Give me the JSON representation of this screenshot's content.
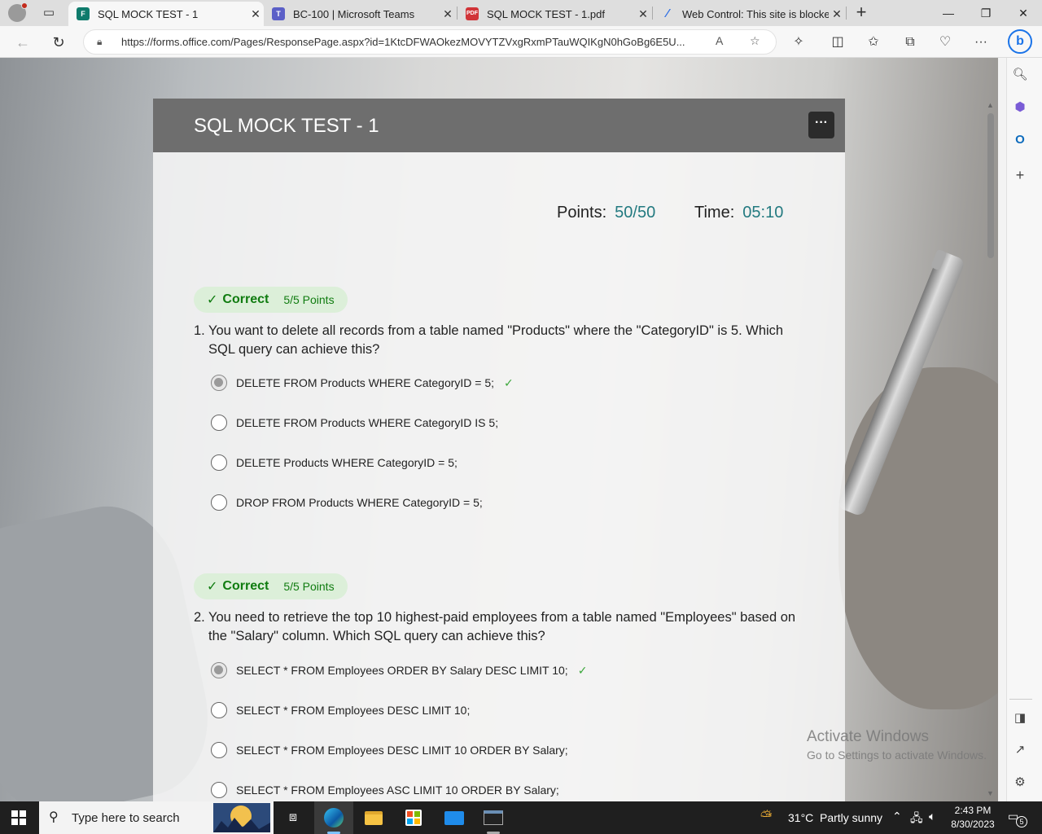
{
  "browser": {
    "tabs": [
      {
        "label": "SQL MOCK TEST - 1",
        "icon": "forms-icon",
        "active": true
      },
      {
        "label": "BC-100 | Microsoft Teams",
        "icon": "teams-icon",
        "active": false
      },
      {
        "label": "SQL MOCK TEST - 1.pdf",
        "icon": "pdf-icon",
        "active": false
      },
      {
        "label": "Web Control: This site is blocked.",
        "icon": "webcontrol-icon",
        "active": false
      }
    ],
    "url": "https://forms.office.com/Pages/ResponsePage.aspx?id=1KtcDFWAOkezMOVYTZVxgRxmPTauWQIKgN0hGoBg6E5U..."
  },
  "form": {
    "title": "SQL MOCK TEST - 1",
    "points_label": "Points:",
    "points_value": "50/50",
    "time_label": "Time:",
    "time_value": "05:10",
    "questions": [
      {
        "number": "1.",
        "badge": "Correct",
        "points": "5/5 Points",
        "text": "You want to delete all records from a table named \"Products\" where the \"CategoryID\" is 5. Which SQL query can achieve this?",
        "options": [
          "DELETE FROM Products WHERE CategoryID = 5;",
          "DELETE FROM Products WHERE CategoryID IS 5;",
          "DELETE Products WHERE CategoryID = 5;",
          "DROP FROM Products WHERE CategoryID = 5;"
        ],
        "selected": 0
      },
      {
        "number": "2.",
        "badge": "Correct",
        "points": "5/5 Points",
        "text": "You need to retrieve the top 10 highest-paid employees from a table named \"Employees\" based on the \"Salary\" column. Which SQL query can achieve this?",
        "options": [
          "SELECT * FROM Employees ORDER BY Salary DESC LIMIT 10;",
          "SELECT * FROM Employees DESC LIMIT 10;",
          "SELECT * FROM Employees DESC LIMIT 10 ORDER BY Salary;",
          "SELECT * FROM Employees ASC LIMIT 10 ORDER BY Salary;"
        ],
        "selected": 0
      }
    ]
  },
  "watermark": {
    "title": "Activate Windows",
    "subtitle": "Go to Settings to activate Windows."
  },
  "taskbar": {
    "search_placeholder": "Type here to search",
    "weather_temp": "31°C",
    "weather_desc": "Partly sunny",
    "time": "2:43 PM",
    "date": "8/30/2023",
    "notification_count": "5"
  },
  "colors": {
    "correct_green": "#107c10",
    "score_teal": "#237a80",
    "header_gray": "#6e6e6e"
  }
}
